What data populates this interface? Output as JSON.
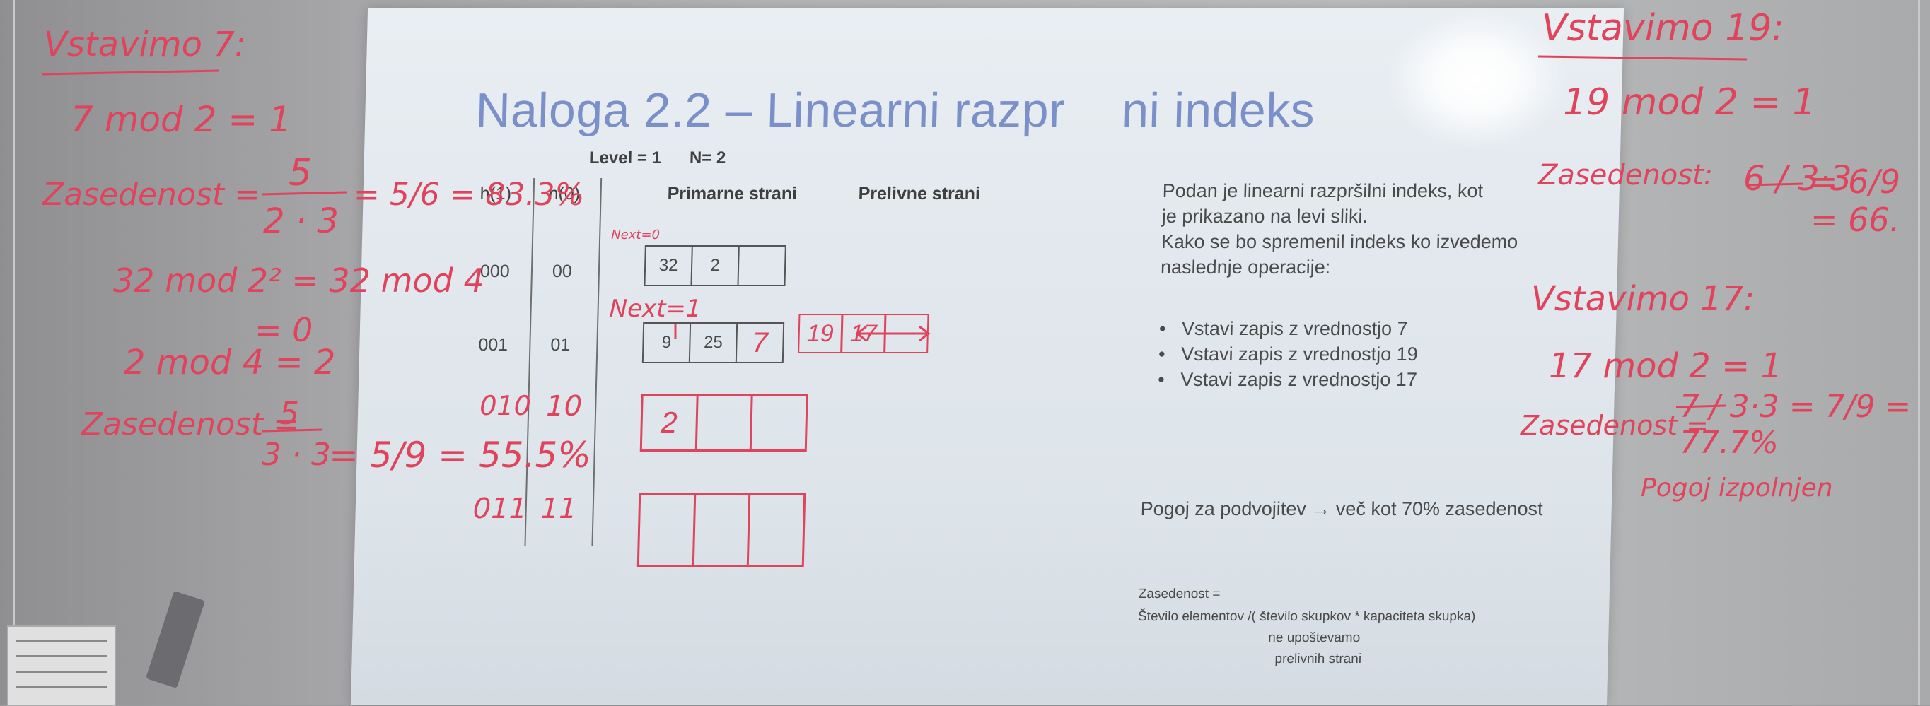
{
  "slide": {
    "title": "Naloga 2.2 – Linearni razpr",
    "title_tail": "ni indeks",
    "level_label": "Level = 1",
    "n_label": "N= 2",
    "col_h1": "h(1)",
    "col_h0": "h(0)",
    "col_primary": "Primarne strani",
    "col_overflow": "Prelivne strani",
    "rows": [
      {
        "h1": "000",
        "h0": "00",
        "values": [
          "32",
          "2",
          ""
        ]
      },
      {
        "h1": "001",
        "h0": "01",
        "values": [
          "9",
          "25",
          "7"
        ]
      }
    ],
    "overflow_values": [
      "19",
      "17",
      ""
    ],
    "description": [
      "Podan je linearni razpršilni indeks, kot",
      "je prikazano na levi sliki.",
      "Kako se bo spremenil indeks ko izvedemo",
      "naslednje operacije:"
    ],
    "bullets": [
      "Vstavi zapis z vrednostjo 7",
      "Vstavi zapis z vrednostjo 19",
      "Vstavi zapis z vrednostjo 17"
    ],
    "split_rule": "Pogoj za podvojitev → več kot 70% zasedenost",
    "occupancy_label": "Zasedenost =",
    "occupancy_formula": "Število elementov /( število skupkov * kapaciteta skupka)",
    "occupancy_note_1": "ne upoštevamo",
    "occupancy_note_2": "prelivnih strani"
  },
  "handwriting": {
    "left": {
      "heading": "Vstavimo 7:",
      "line1": "7 mod 2 = 1",
      "occ1_label": "Zasedenost =",
      "occ1_num": "5",
      "occ1_den": "2 · 3",
      "occ1_result": "= 5/6 = 83.3%",
      "line2": "32 mod 2² = 32 mod 4",
      "line3": "= 0",
      "line4": "2 mod 4 = 2",
      "occ2_label": "Zasedenost =",
      "occ2_num": "5",
      "occ2_den": "3 · 3",
      "occ2_result": "= 5/9 = 55.5%"
    },
    "slide": {
      "next0": "Next=0",
      "next1": "Next=1",
      "new_h1_a": "010",
      "new_h0_a": "10",
      "new_h1_b": "011",
      "new_h0_b": "11",
      "new_bucket_value": "2"
    },
    "right": {
      "heading19": "Vstavimo 19:",
      "line19": "19 mod 2 = 1",
      "occ19_label": "Zasedenost:",
      "occ19_frac1": "6 / 3·3",
      "occ19_frac2": "= 6/9 = 66.",
      "heading17": "Vstavimo 17:",
      "line17": "17 mod 2 = 1",
      "occ17_label": "Zasedenost =",
      "occ17_frac": "7 / 3·3 = 7/9 = 77.7%",
      "note": "Pogoj izpolnjen"
    }
  },
  "colors": {
    "marker_red": "#e0445d",
    "slide_title_blue": "#7b8fc9",
    "slide_bg": "#e3e9ee"
  }
}
